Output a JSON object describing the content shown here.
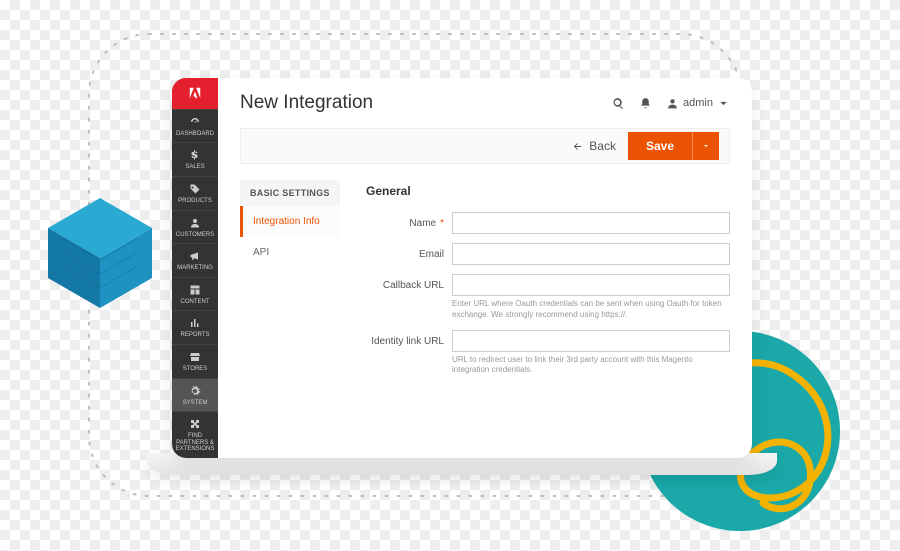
{
  "page": {
    "title": "New Integration"
  },
  "header": {
    "user_label": "admin"
  },
  "actions": {
    "back_label": "Back",
    "save_label": "Save"
  },
  "sidebar": {
    "items": [
      {
        "label": "DASHBOARD"
      },
      {
        "label": "SALES"
      },
      {
        "label": "PRODUCTS"
      },
      {
        "label": "CUSTOMERS"
      },
      {
        "label": "MARKETING"
      },
      {
        "label": "CONTENT"
      },
      {
        "label": "REPORTS"
      },
      {
        "label": "STORES"
      },
      {
        "label": "SYSTEM"
      },
      {
        "label": "FIND PARTNERS & EXTENSIONS"
      }
    ]
  },
  "settings_nav": {
    "heading": "BASIC SETTINGS",
    "tabs": [
      {
        "label": "Integration Info"
      },
      {
        "label": "API"
      }
    ]
  },
  "form": {
    "section_title": "General",
    "fields": {
      "name": {
        "label": "Name",
        "value": "",
        "required": true
      },
      "email": {
        "label": "Email",
        "value": ""
      },
      "callback_url": {
        "label": "Callback URL",
        "value": "",
        "hint": "Enter URL where Oauth credentials can be sent when using Oauth for token exchange. We strongly recommend using https://."
      },
      "identity_link_url": {
        "label": "Identity link URL",
        "value": "",
        "hint": "URL to redirect user to link their 3rd party account with this Magento integration credentials."
      }
    }
  },
  "colors": {
    "accent": "#eb5202",
    "brand": "#e5202e",
    "teal": "#1aa8a8"
  }
}
